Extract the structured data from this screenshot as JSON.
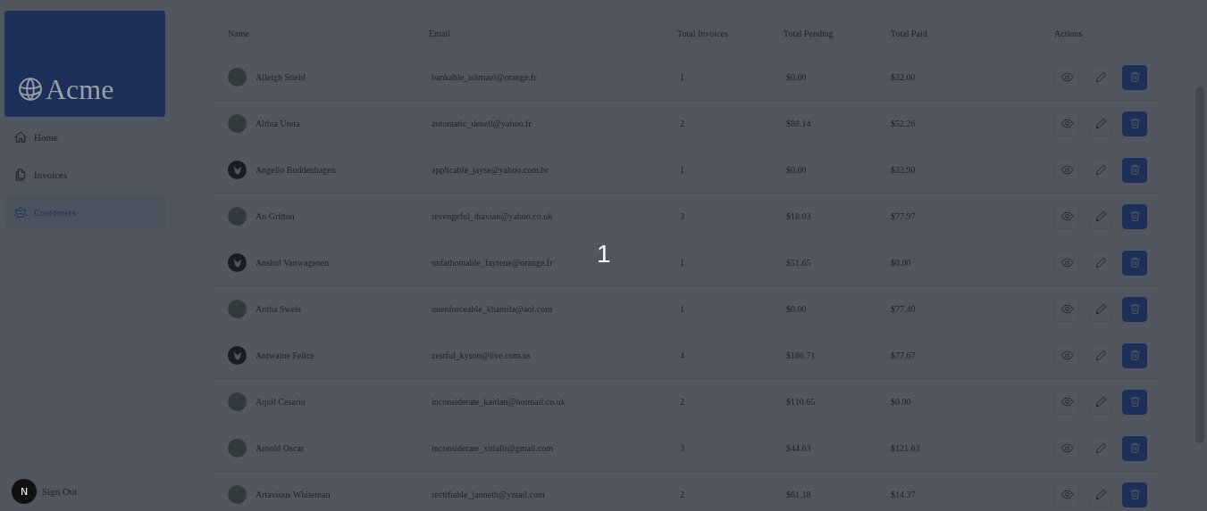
{
  "sidebar": {
    "logo": "Acme",
    "items": [
      {
        "label": "Home",
        "selected": false
      },
      {
        "label": "Invoices",
        "selected": false
      },
      {
        "label": "Customers",
        "selected": true
      }
    ],
    "sign_out": "Sign Out"
  },
  "table": {
    "columns": [
      "Name",
      "Email",
      "Total Invoices",
      "Total Pending",
      "Total Paid",
      "Actions"
    ],
    "rows": [
      {
        "kind": "photo",
        "name": "Alleigh Stiehl",
        "email": "bankable_ishmael@orange.fr",
        "invoices": "1",
        "pending": "$0.00",
        "paid": "$32.00"
      },
      {
        "kind": "photo",
        "name": "Althia Ureta",
        "email": "automatic_denell@yahoo.fr",
        "invoices": "2",
        "pending": "$88.14",
        "paid": "$52.26"
      },
      {
        "kind": "logo",
        "name": "Angello Buddenhagen",
        "email": "applicable_jayse@yahoo.com.br",
        "invoices": "1",
        "pending": "$0.00",
        "paid": "$33.90"
      },
      {
        "kind": "photo",
        "name": "An Gritton",
        "email": "revengeful_diavian@yahoo.co.uk",
        "invoices": "3",
        "pending": "$18.03",
        "paid": "$77.97"
      },
      {
        "kind": "logo",
        "name": "Anshul Vanwagenen",
        "email": "unfathomable_fayrene@orange.fr",
        "invoices": "1",
        "pending": "$51.65",
        "paid": "$0.00"
      },
      {
        "kind": "photo",
        "name": "Antha Sweis",
        "email": "unenforceable_khamila@aol.com",
        "invoices": "1",
        "pending": "$0.00",
        "paid": "$77.40"
      },
      {
        "kind": "logo",
        "name": "Antwaine Felice",
        "email": "zestful_kyson@live.com.us",
        "invoices": "4",
        "pending": "$186.71",
        "paid": "$77.67"
      },
      {
        "kind": "photo",
        "name": "Aquil Cesario",
        "email": "inconsiderate_kaitlan@hotmail.co.uk",
        "invoices": "2",
        "pending": "$110.65",
        "paid": "$0.00"
      },
      {
        "kind": "photo",
        "name": "Arnold Oscar",
        "email": "inconsiderate_xitlalli@gmail.com",
        "invoices": "3",
        "pending": "$44.63",
        "paid": "$121.63"
      },
      {
        "kind": "photo",
        "name": "Artavious Whiteman",
        "email": "rectifiable_janneth@ymail.com",
        "invoices": "2",
        "pending": "$61.18",
        "paid": "$14.37"
      }
    ]
  },
  "overlay": {
    "counter": "1"
  },
  "dev_badge": "N"
}
